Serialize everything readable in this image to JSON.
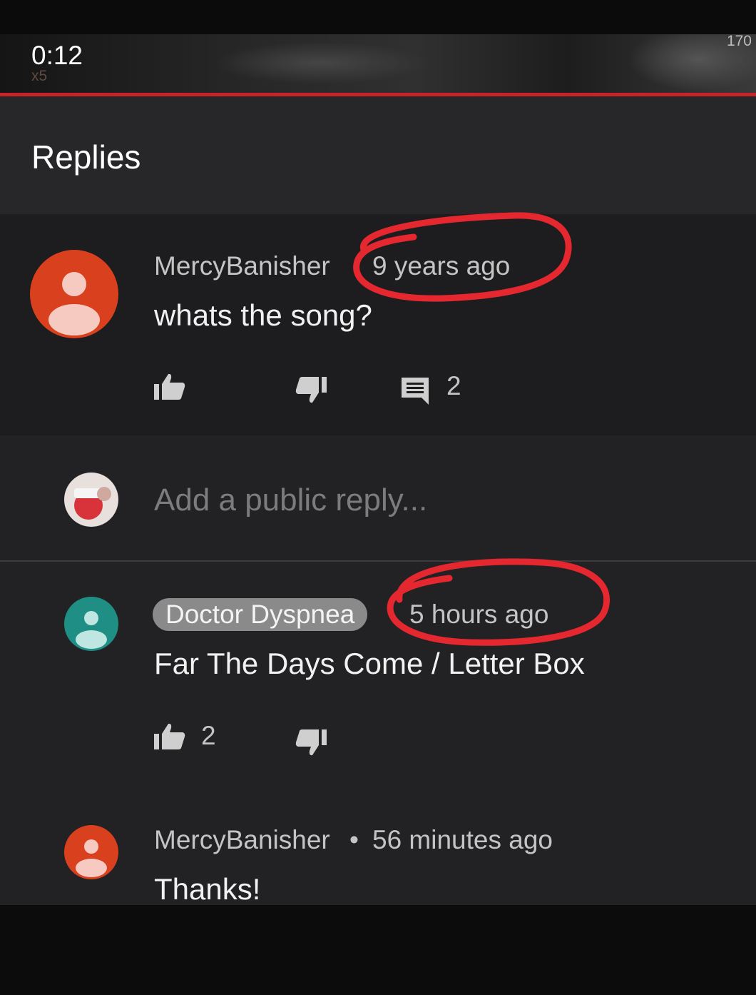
{
  "player": {
    "time": "0:12",
    "speed": "x5",
    "counter": "170"
  },
  "header": {
    "title": "Replies"
  },
  "top_comment": {
    "author": "MercyBanisher",
    "time": "9 years ago",
    "text": "whats the song?",
    "reply_count": "2"
  },
  "reply_box": {
    "placeholder": "Add a public reply..."
  },
  "replies": [
    {
      "author": "Doctor Dyspnea",
      "time": "5 hours ago",
      "text": "Far The Days Come / Letter Box",
      "likes": "2"
    },
    {
      "author": "MercyBanisher",
      "separator": "•",
      "time": "56 minutes ago",
      "text": "Thanks!"
    }
  ],
  "colors": {
    "progress": "#c8222b",
    "annotation": "#e5272f",
    "avatar_orange": "#d9411e",
    "avatar_teal": "#1f8f86"
  }
}
